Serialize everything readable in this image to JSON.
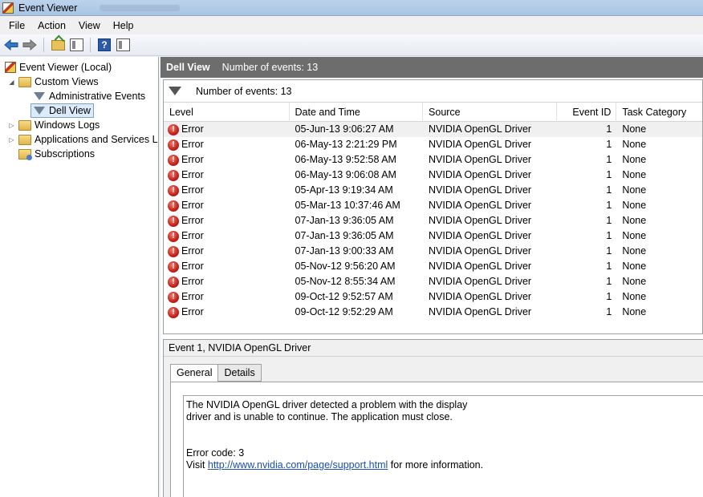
{
  "window": {
    "title": "Event Viewer"
  },
  "menu": {
    "items": [
      "File",
      "Action",
      "View",
      "Help"
    ]
  },
  "tree": {
    "root": "Event Viewer (Local)",
    "custom_views": "Custom Views",
    "administrative_events": "Administrative Events",
    "dell_view": "Dell View",
    "windows_logs": "Windows Logs",
    "apps_services": "Applications and Services Lo",
    "subscriptions": "Subscriptions"
  },
  "header": {
    "title": "Dell View",
    "count": "Number of events: 13"
  },
  "events": {
    "filter_text": "Number of events: 13",
    "columns": {
      "level": "Level",
      "date": "Date and Time",
      "source": "Source",
      "event_id": "Event ID",
      "task": "Task Category"
    },
    "rows": [
      {
        "level": "Error",
        "date": "05-Jun-13 9:06:27 AM",
        "source": "NVIDIA OpenGL Driver",
        "id": "1",
        "task": "None"
      },
      {
        "level": "Error",
        "date": "06-May-13 2:21:29 PM",
        "source": "NVIDIA OpenGL Driver",
        "id": "1",
        "task": "None"
      },
      {
        "level": "Error",
        "date": "06-May-13 9:52:58 AM",
        "source": "NVIDIA OpenGL Driver",
        "id": "1",
        "task": "None"
      },
      {
        "level": "Error",
        "date": "06-May-13 9:06:08 AM",
        "source": "NVIDIA OpenGL Driver",
        "id": "1",
        "task": "None"
      },
      {
        "level": "Error",
        "date": "05-Apr-13 9:19:34 AM",
        "source": "NVIDIA OpenGL Driver",
        "id": "1",
        "task": "None"
      },
      {
        "level": "Error",
        "date": "05-Mar-13 10:37:46 AM",
        "source": "NVIDIA OpenGL Driver",
        "id": "1",
        "task": "None"
      },
      {
        "level": "Error",
        "date": "07-Jan-13 9:36:05 AM",
        "source": "NVIDIA OpenGL Driver",
        "id": "1",
        "task": "None"
      },
      {
        "level": "Error",
        "date": "07-Jan-13 9:36:05 AM",
        "source": "NVIDIA OpenGL Driver",
        "id": "1",
        "task": "None"
      },
      {
        "level": "Error",
        "date": "07-Jan-13 9:00:33 AM",
        "source": "NVIDIA OpenGL Driver",
        "id": "1",
        "task": "None"
      },
      {
        "level": "Error",
        "date": "05-Nov-12 9:56:20 AM",
        "source": "NVIDIA OpenGL Driver",
        "id": "1",
        "task": "None"
      },
      {
        "level": "Error",
        "date": "05-Nov-12 8:55:34 AM",
        "source": "NVIDIA OpenGL Driver",
        "id": "1",
        "task": "None"
      },
      {
        "level": "Error",
        "date": "09-Oct-12 9:52:57 AM",
        "source": "NVIDIA OpenGL Driver",
        "id": "1",
        "task": "None"
      },
      {
        "level": "Error",
        "date": "09-Oct-12 9:52:29 AM",
        "source": "NVIDIA OpenGL Driver",
        "id": "1",
        "task": "None"
      }
    ]
  },
  "detail": {
    "title": "Event 1, NVIDIA OpenGL Driver",
    "tabs": {
      "general": "General",
      "details": "Details"
    },
    "message_line1": "The NVIDIA OpenGL driver detected a problem with the display",
    "message_line2": "driver and is unable to continue. The application must close.",
    "error_code": "Error code: 3",
    "visit_prefix": "Visit",
    "link": "http://www.nvidia.com/page/support.html",
    "visit_suffix": "for more information."
  }
}
